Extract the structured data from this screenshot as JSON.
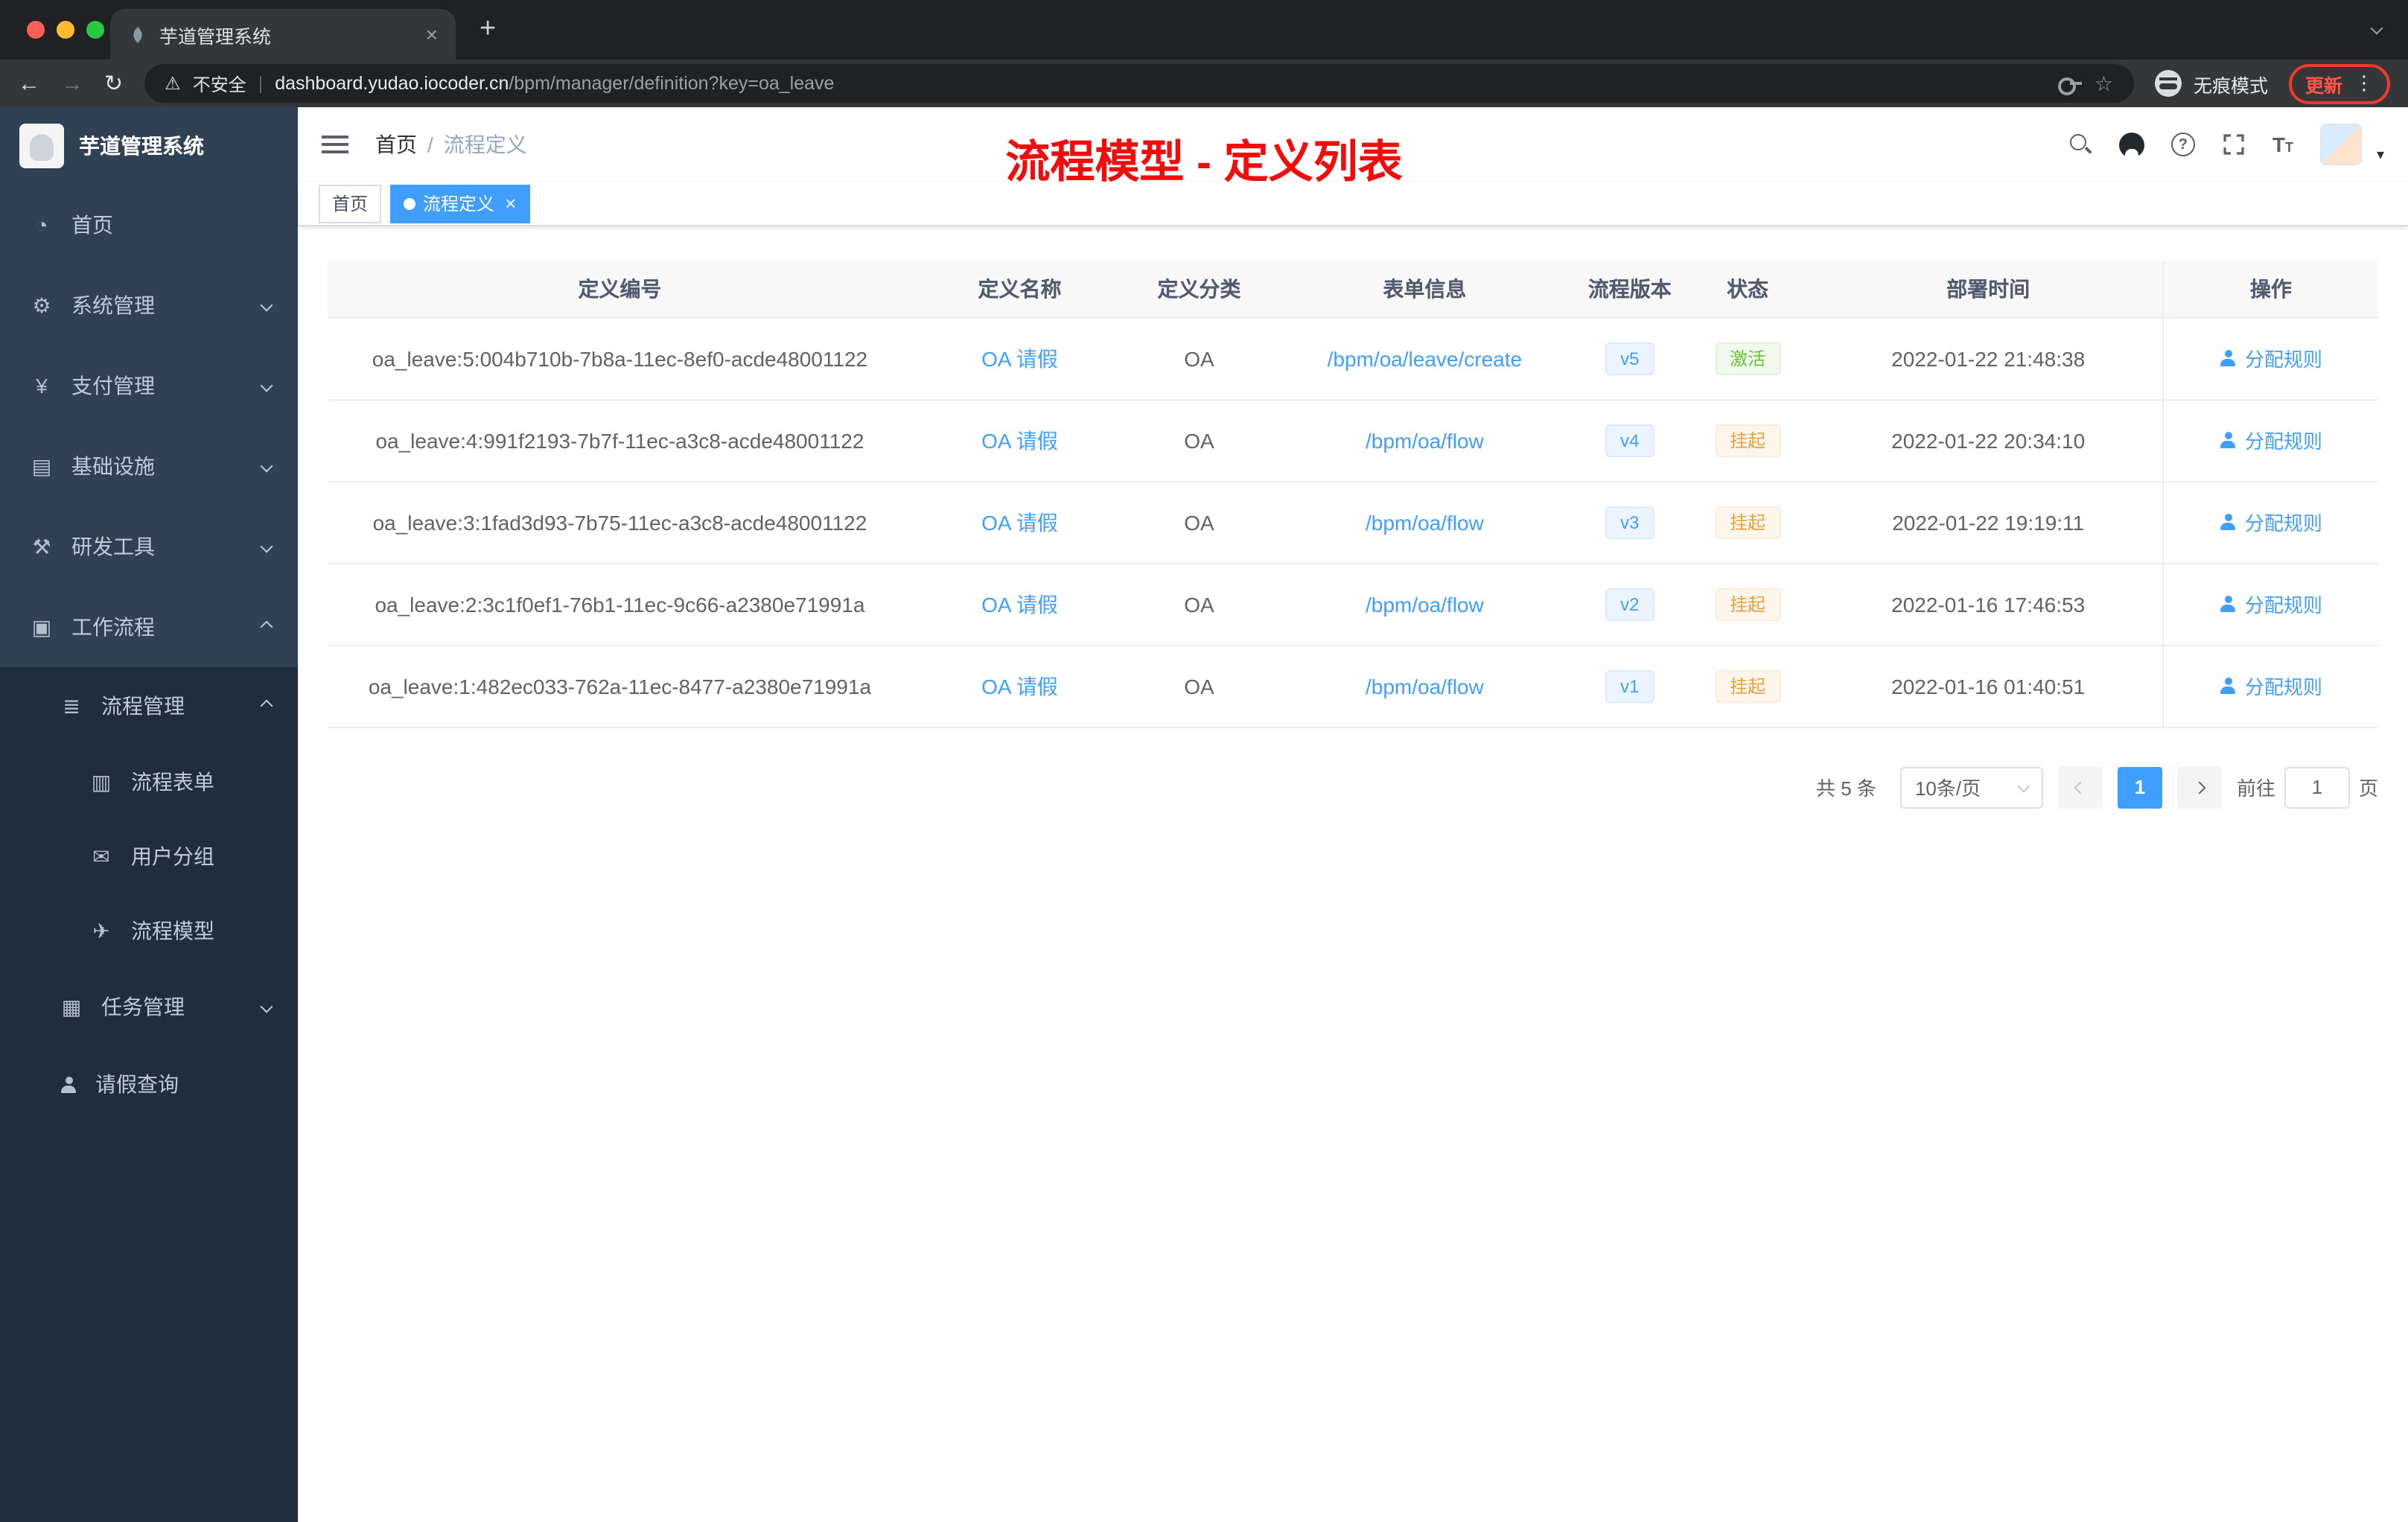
{
  "browser": {
    "tab_title": "芋道管理系统",
    "security_label": "不安全",
    "url_host": "dashboard.yudao.iocoder.cn",
    "url_path": "/bpm/manager/definition?key=oa_leave",
    "incognito_label": "无痕模式",
    "update_label": "更新"
  },
  "sidebar": {
    "title": "芋道管理系统",
    "menu": [
      {
        "label": "首页",
        "icon": "dashboard-icon"
      },
      {
        "label": "系统管理",
        "icon": "gear-icon"
      },
      {
        "label": "支付管理",
        "icon": "yen-icon"
      },
      {
        "label": "基础设施",
        "icon": "infrastructure-icon"
      },
      {
        "label": "研发工具",
        "icon": "tools-icon"
      },
      {
        "label": "工作流程",
        "icon": "briefcase-icon"
      },
      {
        "label": "流程管理",
        "icon": "list-icon"
      },
      {
        "label": "流程表单",
        "icon": "form-icon"
      },
      {
        "label": "用户分组",
        "icon": "chat-icon"
      },
      {
        "label": "流程模型",
        "icon": "send-icon"
      },
      {
        "label": "任务管理",
        "icon": "tasks-icon"
      },
      {
        "label": "请假查询",
        "icon": "person-icon"
      }
    ]
  },
  "header": {
    "breadcrumb_home": "首页",
    "breadcrumb_current": "流程定义",
    "annotation_title": "流程模型 - 定义列表"
  },
  "tags": {
    "home": "首页",
    "active": "流程定义"
  },
  "table": {
    "columns": [
      "定义编号",
      "定义名称",
      "定义分类",
      "表单信息",
      "流程版本",
      "状态",
      "部署时间",
      "操作"
    ],
    "rows": [
      {
        "id": "oa_leave:5:004b710b-7b8a-11ec-8ef0-acde48001122",
        "name": "OA 请假",
        "category": "OA",
        "form": "/bpm/oa/leave/create",
        "version": "v5",
        "status": "激活",
        "status_type": "success",
        "deploy_time": "2022-01-22 21:48:38",
        "action": "分配规则"
      },
      {
        "id": "oa_leave:4:991f2193-7b7f-11ec-a3c8-acde48001122",
        "name": "OA 请假",
        "category": "OA",
        "form": "/bpm/oa/flow",
        "version": "v4",
        "status": "挂起",
        "status_type": "warning",
        "deploy_time": "2022-01-22 20:34:10",
        "action": "分配规则"
      },
      {
        "id": "oa_leave:3:1fad3d93-7b75-11ec-a3c8-acde48001122",
        "name": "OA 请假",
        "category": "OA",
        "form": "/bpm/oa/flow",
        "version": "v3",
        "status": "挂起",
        "status_type": "warning",
        "deploy_time": "2022-01-22 19:19:11",
        "action": "分配规则"
      },
      {
        "id": "oa_leave:2:3c1f0ef1-76b1-11ec-9c66-a2380e71991a",
        "name": "OA 请假",
        "category": "OA",
        "form": "/bpm/oa/flow",
        "version": "v2",
        "status": "挂起",
        "status_type": "warning",
        "deploy_time": "2022-01-16 17:46:53",
        "action": "分配规则"
      },
      {
        "id": "oa_leave:1:482ec033-762a-11ec-8477-a2380e71991a",
        "name": "OA 请假",
        "category": "OA",
        "form": "/bpm/oa/flow",
        "version": "v1",
        "status": "挂起",
        "status_type": "warning",
        "deploy_time": "2022-01-16 01:40:51",
        "action": "分配规则"
      }
    ]
  },
  "pagination": {
    "total_label": "共 5 条",
    "page_size": "10条/页",
    "current_page": "1",
    "goto_label": "前往",
    "goto_value": "1",
    "page_suffix": "页"
  },
  "colors": {
    "accent": "#409eff",
    "success": "#67c23a",
    "warning": "#e6a23c",
    "annotation": "#f20d0d",
    "sidebar_bg": "#304156",
    "submenu_bg": "#1f2d3d"
  }
}
